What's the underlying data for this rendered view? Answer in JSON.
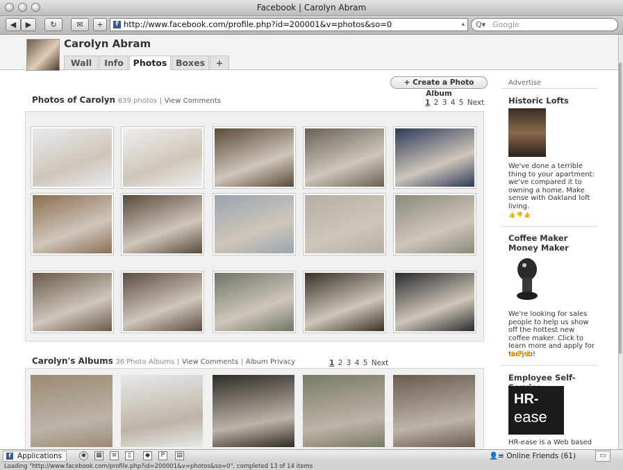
{
  "window": {
    "title": "Facebook | Carolyn Abram"
  },
  "toolbar": {
    "back_glyph": "◀",
    "forward_glyph": "▶",
    "reload_glyph": "↻",
    "bookmark_glyph": "✉",
    "add_glyph": "+",
    "url": "http://www.facebook.com/profile.php?id=200001&v=photos&so=0",
    "search_placeholder": "Google",
    "search_icon_glyph": "Q▾"
  },
  "profile": {
    "name": "Carolyn Abram",
    "tabs": [
      {
        "label": "Wall"
      },
      {
        "label": "Info"
      },
      {
        "label": "Photos"
      },
      {
        "label": "Boxes"
      },
      {
        "label": "+"
      }
    ],
    "active_tab": "Photos"
  },
  "photos": {
    "create_album_label": "+ Create a Photo Album",
    "title": "Photos of Carolyn",
    "count": "639 photos",
    "separator": "|",
    "view_comments": "View Comments",
    "pager": {
      "pages": [
        "1",
        "2",
        "3",
        "4",
        "5"
      ],
      "current": "1",
      "next": "Next"
    },
    "colors": [
      [
        "#e9e9ee",
        "#eeeeee",
        "#5a4a38",
        "#6a6058",
        "#2e3a5a"
      ],
      [
        "#8a6e52",
        "#5a4a3c",
        "#9aa4b0",
        "#b4aea4",
        "#8a8a7a"
      ],
      [
        "#6a5a4a",
        "#5c4c44",
        "#707468",
        "#3a3028",
        "#2a2a2e"
      ]
    ]
  },
  "albums": {
    "title": "Carolyn's Albums",
    "count": "36 Photo Albums",
    "separator": "|",
    "view_comments": "View Comments",
    "album_privacy": "Album Privacy",
    "pager": {
      "pages": [
        "1",
        "2",
        "3",
        "4",
        "5"
      ],
      "current": "1",
      "next": "Next"
    },
    "colors": [
      "#9a8a72",
      "#e8e8e8",
      "#2e2a26",
      "#7a7a64",
      "#6a5a4e"
    ]
  },
  "ads": {
    "header": "Advertise",
    "items": [
      {
        "title": "Historic Lofts",
        "text": "We've done a terrible thing to your apartment: we've compared it to owning a home. Make sense with Oakland loft living.",
        "reactions": "👍👎👍"
      },
      {
        "title": "Coffee Maker Money Maker",
        "text": "We're looking for sales people to help us show off the hottest new coffee maker. Click to learn more and apply for the job!",
        "reactions": "👍👎👍"
      },
      {
        "title": "Employee Self-Service",
        "logo_text_top": "HR-",
        "logo_text_bottom": "ease",
        "text": "HR-ease is a Web based"
      }
    ]
  },
  "bottom_bar": {
    "applications_label": "Applications",
    "fb_glyph": "f",
    "online_friends_label": "Online Friends (",
    "online_friends_count": "61",
    "online_friends_close": ")",
    "friends_icon_glyph": "👤≡",
    "chat_glyph": "▭"
  },
  "status_bar": {
    "text": "Loading \"http://www.facebook.com/profile.php?id=200001&v=photos&so=0\", completed 13 of 14 items"
  }
}
